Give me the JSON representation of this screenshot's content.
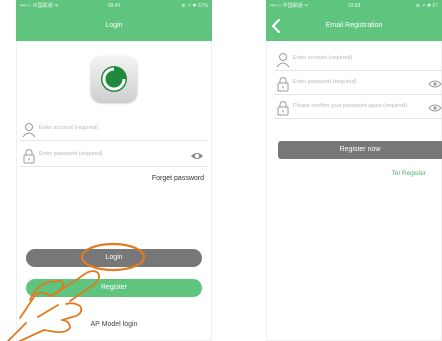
{
  "login_screen": {
    "status": {
      "carrier": "•••○○ 中国联通 ᯤ",
      "time": "09:45",
      "right": "⊕ ↗ ✱ 67%"
    },
    "title": "Login",
    "account_placeholder": "Enter account (required)",
    "password_placeholder": "Enter password (required)",
    "forget_password": "Forget password",
    "login_button": "Login",
    "register_button": "Register",
    "ap_login": "AP Model login"
  },
  "registration_screen": {
    "status": {
      "carrier": "•••○○ 中国联通 ᯤ",
      "time": "10:58",
      "right": "⊕ ↗ ✱ 67"
    },
    "title": "Email Registration",
    "account_placeholder": "Enter account (required)",
    "password_placeholder": "Enter password (required)",
    "confirm_placeholder": "Please confirm your password again (required)",
    "register_now_button": "Register now",
    "tel_register": "Tel Register"
  },
  "colors": {
    "accent": "#5ec47e",
    "button_gray": "#777777",
    "highlight": "#e07b20"
  },
  "icons": [
    "app-logo-icon",
    "user-icon",
    "lock-icon",
    "eye-icon",
    "back-chevron-icon",
    "hand-pointer-icon"
  ]
}
